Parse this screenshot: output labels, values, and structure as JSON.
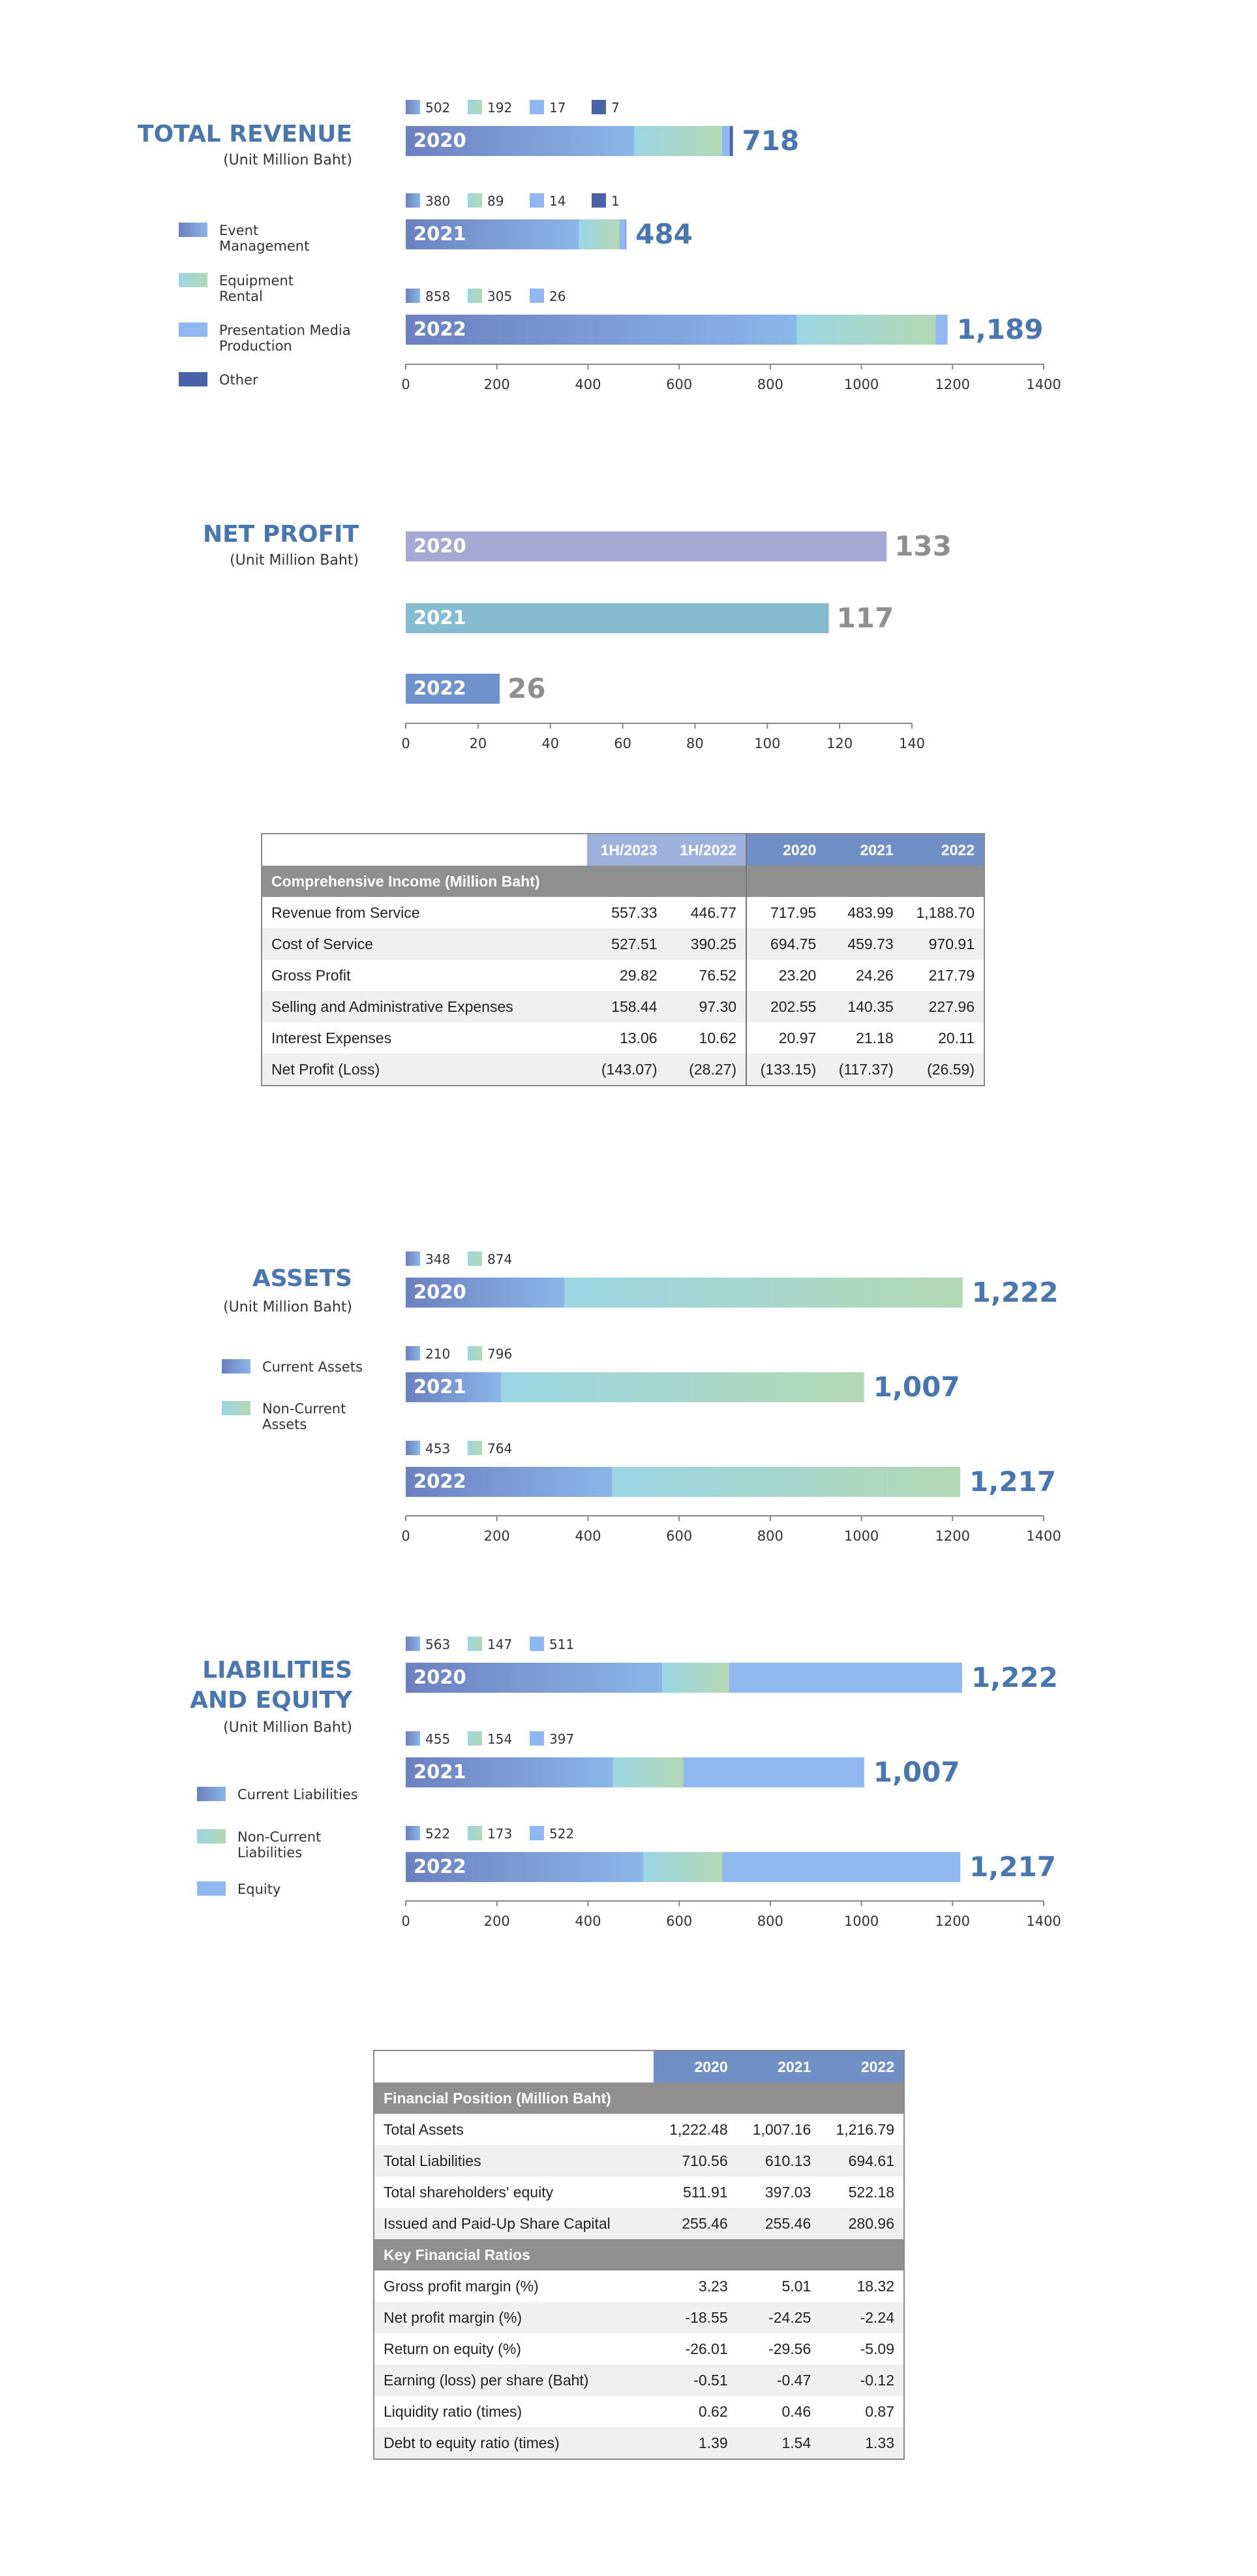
{
  "colors": {
    "title_blue": "#4a76b0",
    "grad1_start": "#6c80c0",
    "grad1_end": "#8bb6e8",
    "grad2_start": "#9ad6e4",
    "grad2_end": "#b4d8b4",
    "light_blue": "#8fb7f0",
    "other": "#4a62a8",
    "np2020": "#a8a8d4",
    "np2021": "#86bccf",
    "np2022": "#6d92cc",
    "grey_text": "#8f8f8f"
  },
  "revenue": {
    "title": "TOTAL REVENUE",
    "unit": "(Unit Million Baht)",
    "legend": [
      {
        "name": "Event\nManagement",
        "icon": "event-swatch"
      },
      {
        "name": "Equipment\nRental",
        "icon": "rental-swatch"
      },
      {
        "name": "Presentation Media\nProduction",
        "icon": "media-swatch"
      },
      {
        "name": "Other",
        "icon": "other-swatch"
      }
    ]
  },
  "net_profit": {
    "title": "NET PROFIT",
    "unit": "(Unit Million Baht)"
  },
  "assets": {
    "title": "ASSETS",
    "unit": "(Unit Million Baht)",
    "legend": [
      {
        "name": "Current Assets"
      },
      {
        "name": "Non-Current\nAssets"
      }
    ]
  },
  "liabilities": {
    "title_line1": "LIABILITIES",
    "title_line2": "AND EQUITY",
    "unit": "(Unit Million Baht)",
    "legend": [
      {
        "name": "Current Liabilities"
      },
      {
        "name": "Non-Current\nLiabilities"
      },
      {
        "name": "Equity"
      }
    ]
  },
  "chart_data": [
    {
      "type": "bar",
      "orientation": "horizontal",
      "stacked": true,
      "title": "TOTAL REVENUE",
      "categories": [
        "2020",
        "2021",
        "2022"
      ],
      "series": [
        {
          "name": "Event Management",
          "values": [
            502,
            380,
            858
          ]
        },
        {
          "name": "Equipment Rental",
          "values": [
            192,
            89,
            305
          ]
        },
        {
          "name": "Presentation Media Production",
          "values": [
            17,
            14,
            26
          ]
        },
        {
          "name": "Other",
          "values": [
            7,
            1,
            0
          ]
        }
      ],
      "segment_labels": [
        [
          "502",
          "192",
          "17",
          "7"
        ],
        [
          "380",
          "89",
          "14",
          "1"
        ],
        [
          "858",
          "305",
          "26"
        ]
      ],
      "totals": [
        "718",
        "484",
        "1,189"
      ],
      "xlim": [
        0,
        1400
      ],
      "xticks": [
        "0",
        "200",
        "400",
        "600",
        "800",
        "1000",
        "1200",
        "1400"
      ]
    },
    {
      "type": "bar",
      "orientation": "horizontal",
      "title": "NET PROFIT",
      "categories": [
        "2020",
        "2021",
        "2022"
      ],
      "values": [
        133,
        117,
        26
      ],
      "value_labels": [
        "133",
        "117",
        "26"
      ],
      "xlim": [
        0,
        140
      ],
      "xticks": [
        "0",
        "20",
        "40",
        "60",
        "80",
        "100",
        "120",
        "140"
      ]
    },
    {
      "type": "bar",
      "orientation": "horizontal",
      "stacked": true,
      "title": "ASSETS",
      "categories": [
        "2020",
        "2021",
        "2022"
      ],
      "series": [
        {
          "name": "Current Assets",
          "values": [
            348,
            210,
            453
          ]
        },
        {
          "name": "Non-Current Assets",
          "values": [
            874,
            796,
            764
          ]
        }
      ],
      "segment_labels": [
        [
          "348",
          "874"
        ],
        [
          "210",
          "796"
        ],
        [
          "453",
          "764"
        ]
      ],
      "totals": [
        "1,222",
        "1,007",
        "1,217"
      ],
      "xlim": [
        0,
        1400
      ],
      "xticks": [
        "0",
        "200",
        "400",
        "600",
        "800",
        "1000",
        "1200",
        "1400"
      ]
    },
    {
      "type": "bar",
      "orientation": "horizontal",
      "stacked": true,
      "title": "LIABILITIES AND EQUITY",
      "categories": [
        "2020",
        "2021",
        "2022"
      ],
      "series": [
        {
          "name": "Current Liabilities",
          "values": [
            563,
            455,
            522
          ]
        },
        {
          "name": "Non-Current Liabilities",
          "values": [
            147,
            154,
            173
          ]
        },
        {
          "name": "Equity",
          "values": [
            511,
            397,
            522
          ]
        }
      ],
      "segment_labels": [
        [
          "563",
          "147",
          "511"
        ],
        [
          "455",
          "154",
          "397"
        ],
        [
          "522",
          "173",
          "522"
        ]
      ],
      "totals": [
        "1,222",
        "1,007",
        "1,217"
      ],
      "xlim": [
        0,
        1400
      ],
      "xticks": [
        "0",
        "200",
        "400",
        "600",
        "800",
        "1000",
        "1200",
        "1400"
      ]
    },
    {
      "type": "table",
      "title": "Comprehensive Income (Million Baht)",
      "columns": [
        "1H/2023",
        "1H/2022",
        "2020",
        "2021",
        "2022"
      ],
      "rows": [
        {
          "label": "Revenue from Service",
          "values": [
            "557.33",
            "446.77",
            "717.95",
            "483.99",
            "1,188.70"
          ]
        },
        {
          "label": "Cost of Service",
          "values": [
            "527.51",
            "390.25",
            "694.75",
            "459.73",
            "970.91"
          ]
        },
        {
          "label": "Gross Profit",
          "values": [
            "29.82",
            "76.52",
            "23.20",
            "24.26",
            "217.79"
          ]
        },
        {
          "label": "Selling and Administrative Expenses",
          "values": [
            "158.44",
            "97.30",
            "202.55",
            "140.35",
            "227.96"
          ]
        },
        {
          "label": "Interest Expenses",
          "values": [
            "13.06",
            "10.62",
            "20.97",
            "21.18",
            "20.11"
          ]
        },
        {
          "label": "Net Profit (Loss)",
          "values": [
            "(143.07)",
            "(28.27)",
            "(133.15)",
            "(117.37)",
            "(26.59)"
          ]
        }
      ]
    },
    {
      "type": "table",
      "columns": [
        "2020",
        "2021",
        "2022"
      ],
      "sections": [
        {
          "title": "Financial Position (Million Baht)",
          "rows": [
            {
              "label": "Total Assets",
              "values": [
                "1,222.48",
                "1,007.16",
                "1,216.79"
              ]
            },
            {
              "label": "Total Liabilities",
              "values": [
                "710.56",
                "610.13",
                "694.61"
              ]
            },
            {
              "label": "Total shareholders' equity",
              "values": [
                "511.91",
                "397.03",
                "522.18"
              ]
            },
            {
              "label": "Issued and Paid-Up Share Capital",
              "values": [
                "255.46",
                "255.46",
                "280.96"
              ]
            }
          ]
        },
        {
          "title": "Key Financial Ratios",
          "rows": [
            {
              "label": "Gross profit margin (%)",
              "values": [
                "3.23",
                "5.01",
                "18.32"
              ]
            },
            {
              "label": "Net profit margin (%)",
              "values": [
                "-18.55",
                "-24.25",
                "-2.24"
              ]
            },
            {
              "label": "Return on equity (%)",
              "values": [
                "-26.01",
                "-29.56",
                "-5.09"
              ]
            },
            {
              "label": "Earning (loss) per share (Baht)",
              "values": [
                "-0.51",
                "-0.47",
                "-0.12"
              ]
            },
            {
              "label": "Liquidity ratio (times)",
              "values": [
                "0.62",
                "0.46",
                "0.87"
              ]
            },
            {
              "label": "Debt to equity ratio (times)",
              "values": [
                "1.39",
                "1.54",
                "1.33"
              ]
            }
          ]
        }
      ]
    }
  ]
}
